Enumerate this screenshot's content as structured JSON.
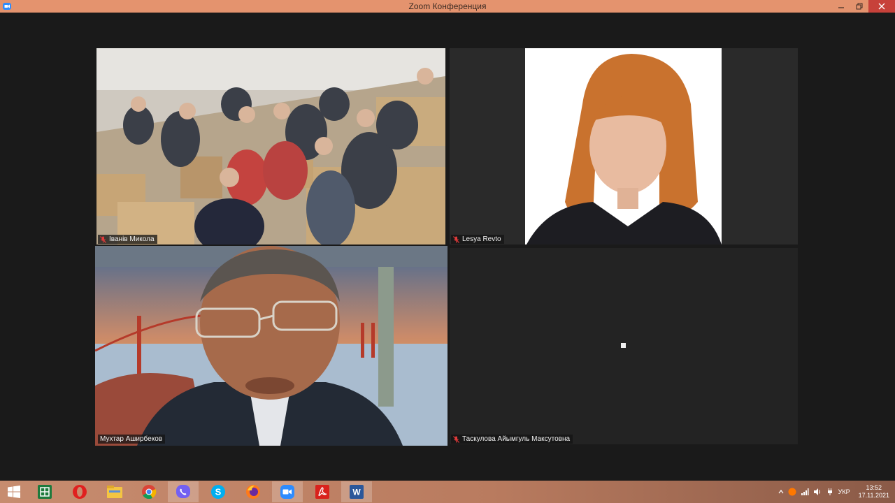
{
  "window": {
    "title": "Zoom Конференция"
  },
  "participants": [
    {
      "name": "Іванів Микола",
      "muted": true
    },
    {
      "name": "Lesya Revto",
      "muted": true
    },
    {
      "name": "Мухтар Аширбеков",
      "muted": false,
      "active_speaker": true
    },
    {
      "name": "Таскулова Айымгуль Максутовна",
      "muted": true
    }
  ],
  "colors": {
    "titlebar": "#e4936e",
    "active_speaker_border": "#cfe05a",
    "muted_icon": "#e23b3b",
    "close_button": "#c7413a"
  },
  "taskbar": {
    "apps": [
      "start-icon",
      "excel-icon",
      "opera-icon",
      "file-explorer-icon",
      "chrome-icon",
      "viber-icon",
      "skype-icon",
      "firefox-icon",
      "zoom-icon",
      "acrobat-icon",
      "word-icon"
    ],
    "language": "УКР",
    "time": "13:52",
    "date": "17.11.2021"
  }
}
